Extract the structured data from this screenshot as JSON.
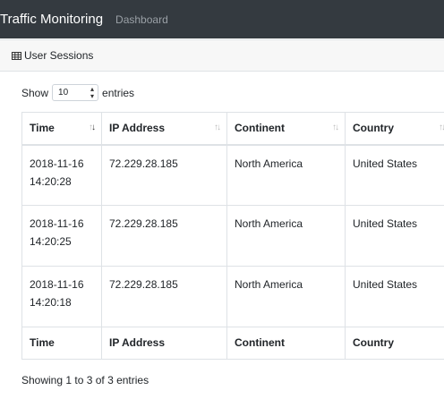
{
  "navbar": {
    "brand": "Traffic Monitoring",
    "link": "Dashboard"
  },
  "card": {
    "header_icon": "table-icon",
    "header_title": "User Sessions"
  },
  "length_control": {
    "prefix": "Show",
    "value": "10",
    "suffix": "entries"
  },
  "table": {
    "columns": [
      "Time",
      "IP Address",
      "Continent",
      "Country"
    ],
    "rows": [
      {
        "time": "2018-11-16 14:20:28",
        "ip": "72.229.28.185",
        "continent": "North America",
        "country": "United States"
      },
      {
        "time": "2018-11-16 14:20:25",
        "ip": "72.229.28.185",
        "continent": "North America",
        "country": "United States"
      },
      {
        "time": "2018-11-16 14:20:18",
        "ip": "72.229.28.185",
        "continent": "North America",
        "country": "United States"
      }
    ],
    "sorted_column": "Time",
    "sort_direction": "descending"
  },
  "info": "Showing 1 to 3 of 3 entries"
}
